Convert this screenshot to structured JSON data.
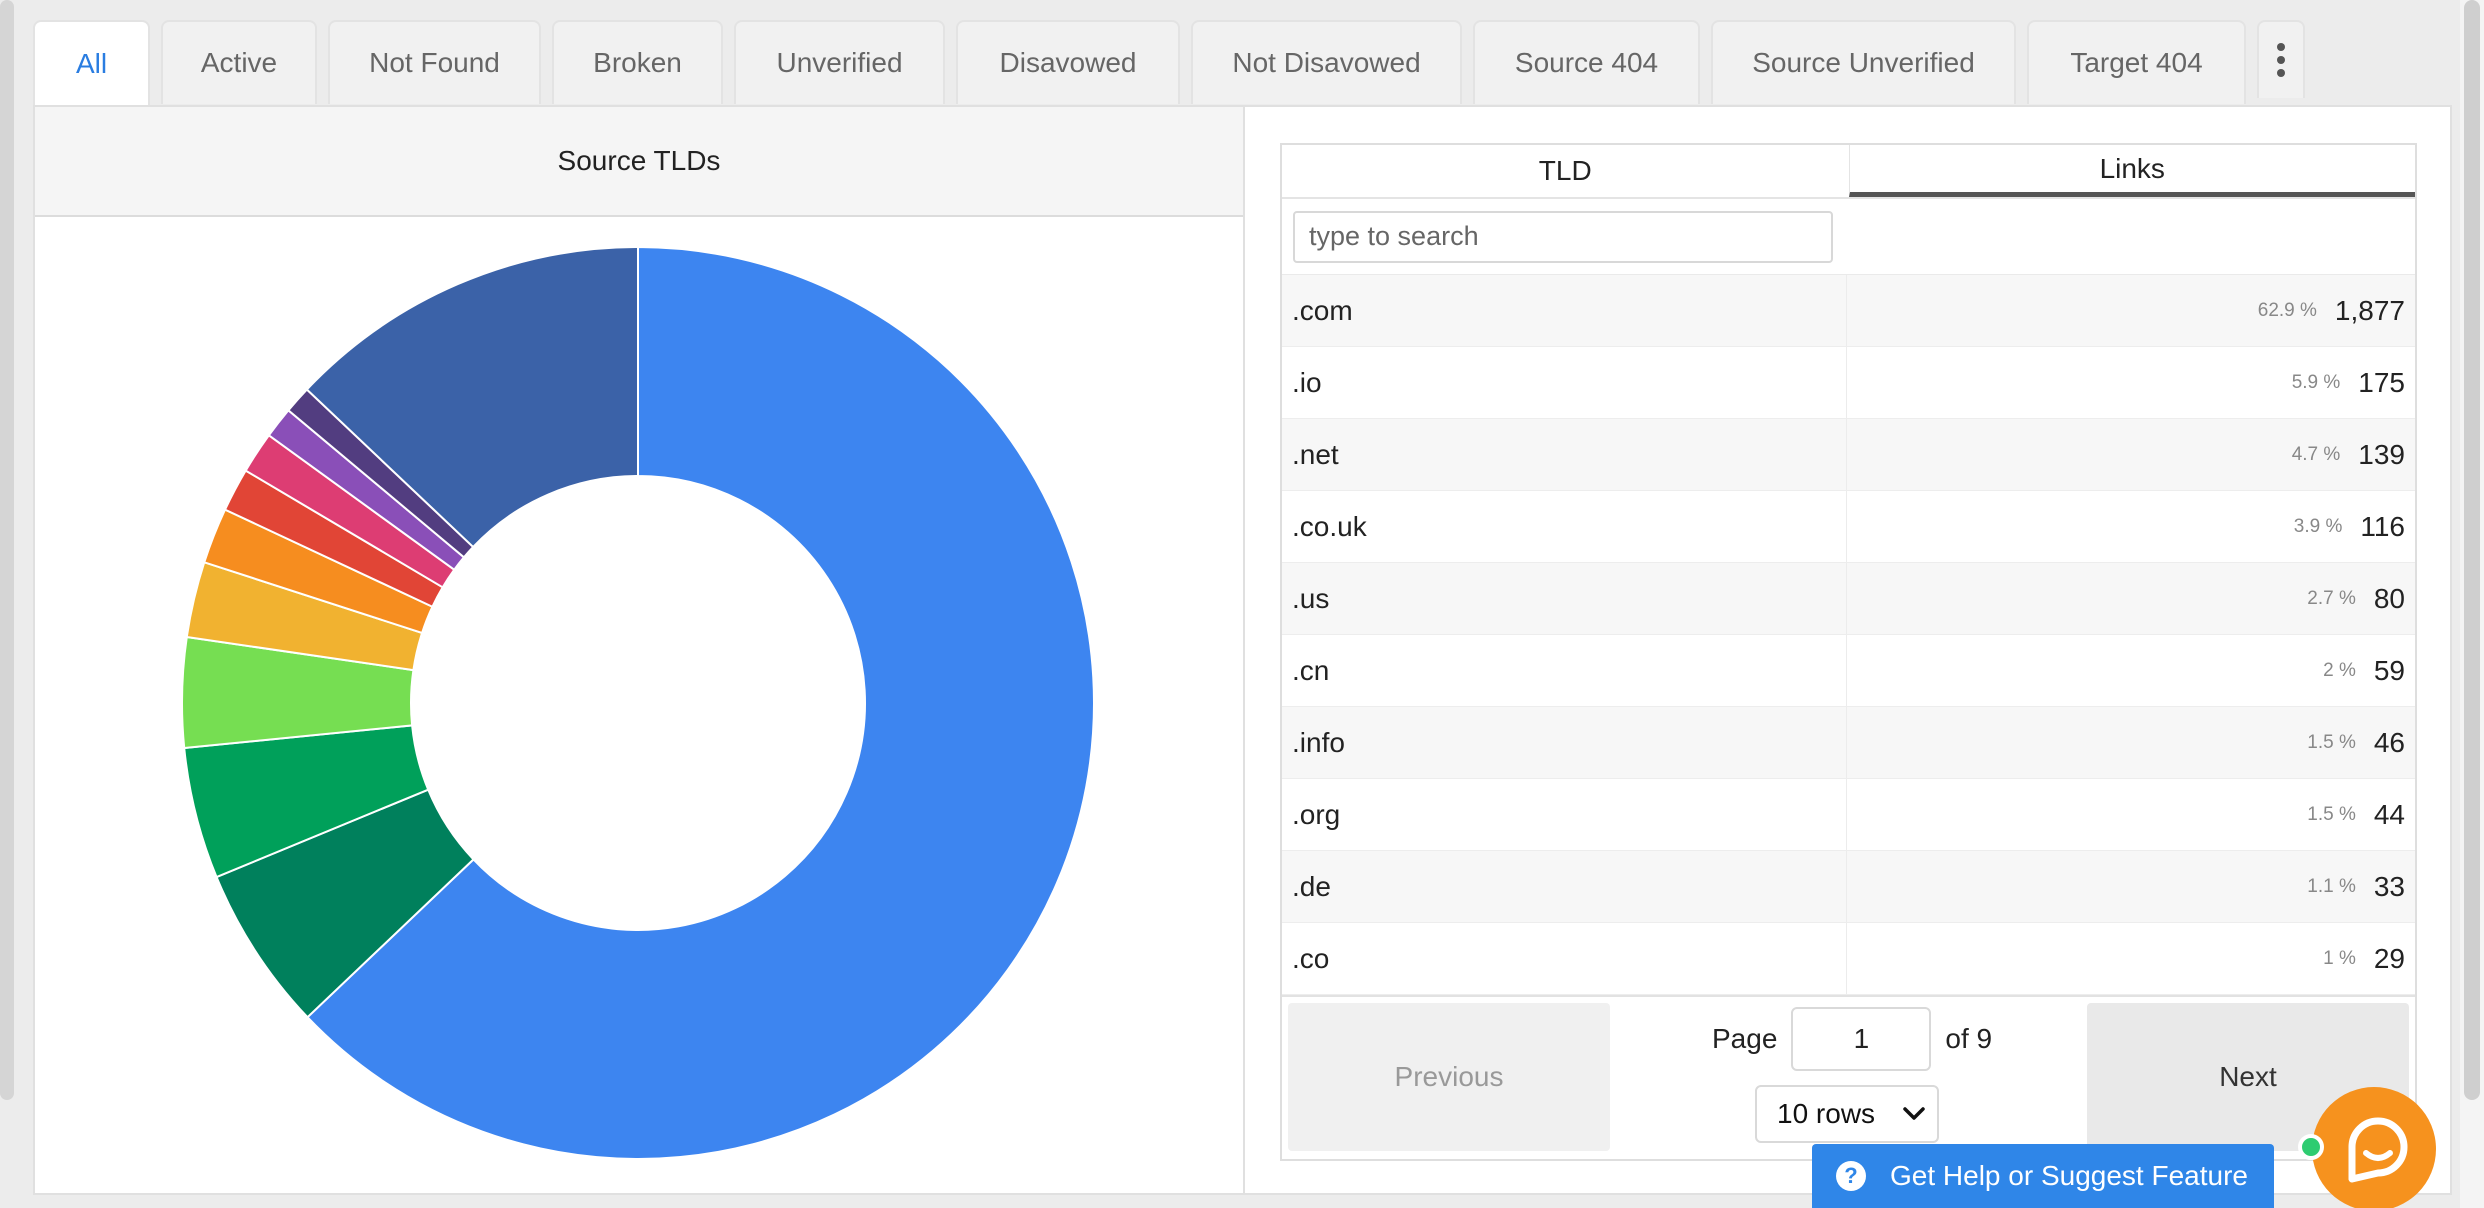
{
  "tabs": [
    {
      "label": "All",
      "active": true
    },
    {
      "label": "Active",
      "active": false
    },
    {
      "label": "Not Found",
      "active": false
    },
    {
      "label": "Broken",
      "active": false
    },
    {
      "label": "Unverified",
      "active": false
    },
    {
      "label": "Disavowed",
      "active": false
    },
    {
      "label": "Not Disavowed",
      "active": false
    },
    {
      "label": "Source 404",
      "active": false
    },
    {
      "label": "Source Unverified",
      "active": false
    },
    {
      "label": "Target 404",
      "active": false
    }
  ],
  "chart_panel": {
    "title": "Source TLDs"
  },
  "chart_data": {
    "type": "pie",
    "title": "Source TLDs",
    "slices": [
      {
        "value": 1877,
        "color": "#3d85f0"
      },
      {
        "value": 175,
        "color": "#00805c"
      },
      {
        "value": 139,
        "color": "#00a05a"
      },
      {
        "value": 116,
        "color": "#76de52"
      },
      {
        "value": 80,
        "color": "#f1b230"
      },
      {
        "value": 59,
        "color": "#f68d1f"
      },
      {
        "value": 46,
        "color": "#e14536"
      },
      {
        "value": 44,
        "color": "#dd3d73"
      },
      {
        "value": 33,
        "color": "#8a4fb8"
      },
      {
        "value": 29,
        "color": "#523d80"
      },
      {
        "value": 386,
        "color": "#3b62a8"
      }
    ]
  },
  "table": {
    "headers": {
      "tld": "TLD",
      "links": "Links"
    },
    "search_placeholder": "type to search",
    "rows": [
      {
        "tld": ".com",
        "pct": "62.9 %",
        "count": "1,877"
      },
      {
        "tld": ".io",
        "pct": "5.9 %",
        "count": "175"
      },
      {
        "tld": ".net",
        "pct": "4.7 %",
        "count": "139"
      },
      {
        "tld": ".co.uk",
        "pct": "3.9 %",
        "count": "116"
      },
      {
        "tld": ".us",
        "pct": "2.7 %",
        "count": "80"
      },
      {
        "tld": ".cn",
        "pct": "2 %",
        "count": "59"
      },
      {
        "tld": ".info",
        "pct": "1.5 %",
        "count": "46"
      },
      {
        "tld": ".org",
        "pct": "1.5 %",
        "count": "44"
      },
      {
        "tld": ".de",
        "pct": "1.1 %",
        "count": "33"
      },
      {
        "tld": ".co",
        "pct": "1 %",
        "count": "29"
      }
    ]
  },
  "pagination": {
    "previous_label": "Previous",
    "next_label": "Next",
    "page_label": "Page",
    "page_value": "1",
    "of_label": "of 9",
    "rows_option": "10 rows"
  },
  "help": {
    "label": "Get Help or Suggest Feature"
  }
}
